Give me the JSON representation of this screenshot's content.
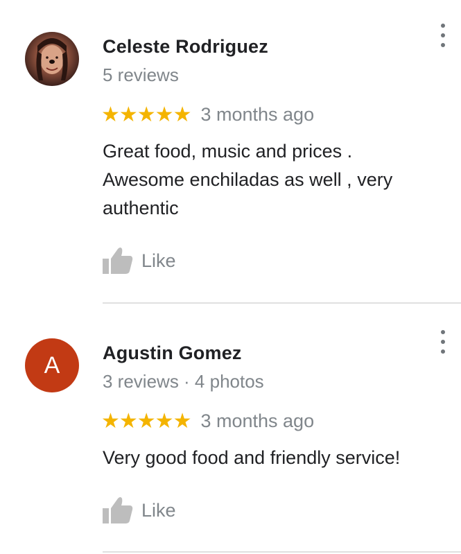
{
  "reviews": [
    {
      "avatar": "profile-photo",
      "name": "Celeste Rodriguez",
      "meta": "5 reviews",
      "stars": "★★★★★",
      "rating": 5,
      "time": "3 months ago",
      "text_lines": [
        "Great food, music and prices .",
        "Awesome enchiladas as well , very",
        "authentic"
      ],
      "like_label": "Like"
    },
    {
      "avatar_letter": "A",
      "name": "Agustin Gomez",
      "meta": "3 reviews · 4 photos",
      "stars": "★★★★★",
      "rating": 5,
      "time": "3 months ago",
      "text_lines": [
        "Very good food and friendly service!"
      ],
      "like_label": "Like"
    }
  ],
  "colors": {
    "star": "#f4b400",
    "avatar_letter_bg": "#c23a14",
    "secondary_text": "#80868b",
    "divider": "#e0e0e0"
  },
  "icons": {
    "more": "more-vert-icon",
    "like": "thumb-up-icon"
  }
}
